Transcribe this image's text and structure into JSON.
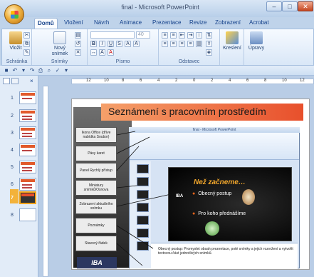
{
  "window": {
    "title": "final - Microsoft PowerPoint",
    "controls": [
      "–",
      "□",
      "✕"
    ]
  },
  "tabs": [
    "Domů",
    "Vložení",
    "Návrh",
    "Animace",
    "Prezentace",
    "Revize",
    "Zobrazení",
    "Acrobat"
  ],
  "active_tab": "Domů",
  "ribbon": {
    "groups": {
      "clipboard": "Schránka",
      "slides": "Snímky",
      "font": "Písmo",
      "paragraph": "Odstavec",
      "drawing": "",
      "editing": ""
    },
    "buttons": {
      "paste": "Vložit",
      "new_slide_line1": "Nový",
      "new_slide_line2": "snímek",
      "drawing": "Kreslení",
      "editing": "Úpravy"
    },
    "font_size": "40"
  },
  "slides": {
    "numbers": [
      "1",
      "2",
      "3",
      "4",
      "5",
      "6",
      "7",
      "8"
    ],
    "selected": "7"
  },
  "ruler": {
    "labels": [
      "12",
      "10",
      "8",
      "6",
      "4",
      "2",
      "0",
      "2",
      "4",
      "6",
      "8",
      "10",
      "12"
    ]
  },
  "slide": {
    "title": "Seznámení s pracovním prostředím",
    "boxes": [
      "Ikona Office (dříve nabídka Soubor)",
      "Pásy karet",
      "Panel Rychlý přístup",
      "Miniatury snímků/Osnova",
      "Zobrazení aktuálního snímku",
      "Poznámky",
      "Stavový řádek"
    ],
    "logo": "IBA"
  },
  "nested": {
    "title": "final - Microsoft PowerPoint",
    "heading": "Než začneme…",
    "bullets": [
      "Obecný postup",
      "Pro koho přednášíme"
    ],
    "logo": "IBA",
    "notes": "Obecný postup: Promyslet obsah prezentace, poté snímky a jejich rozvržení a vytvořit textovou část jednotlivých snímků."
  }
}
